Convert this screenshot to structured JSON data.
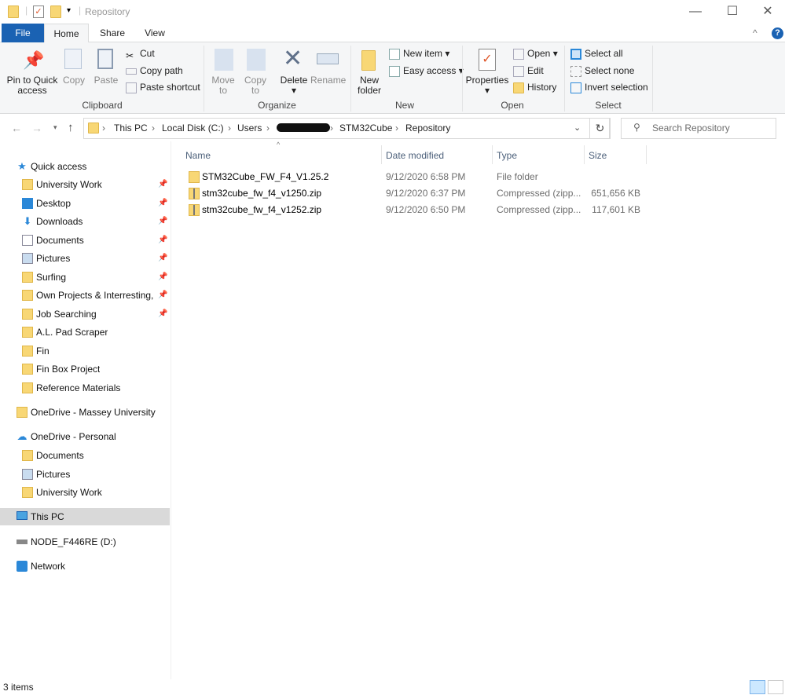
{
  "window": {
    "title": "Repository"
  },
  "tabs": [
    "File",
    "Home",
    "Share",
    "View"
  ],
  "ribbon": {
    "clipboard": {
      "label": "Clipboard",
      "pin": "Pin to Quick access",
      "copy": "Copy",
      "paste": "Paste",
      "cut": "Cut",
      "copy_path": "Copy path",
      "paste_shortcut": "Paste shortcut"
    },
    "organize": {
      "label": "Organize",
      "move_to": "Move to",
      "copy_to": "Copy to",
      "delete": "Delete",
      "rename": "Rename"
    },
    "new": {
      "label": "New",
      "new_folder": "New folder",
      "new_item": "New item",
      "easy_access": "Easy access"
    },
    "open": {
      "label": "Open",
      "properties": "Properties",
      "open": "Open",
      "edit": "Edit",
      "history": "History"
    },
    "select": {
      "label": "Select",
      "select_all": "Select all",
      "select_none": "Select none",
      "invert": "Invert selection"
    }
  },
  "address": {
    "crumbs": [
      "This PC",
      "Local Disk (C:)",
      "Users",
      "STM32Cube",
      "Repository"
    ]
  },
  "search": {
    "placeholder": "Search Repository"
  },
  "sidebar": {
    "quick_access": "Quick access",
    "quick_items": [
      "University Work",
      "Desktop",
      "Downloads",
      "Documents",
      "Pictures",
      "Surfing",
      "Own Projects & Interresting,",
      "Job Searching",
      "A.L. Pad Scraper",
      "Fin",
      "Fin Box Project",
      "Reference Materials"
    ],
    "onedrive_massey": "OneDrive - Massey University",
    "onedrive_personal": "OneDrive - Personal",
    "onedrive_items": [
      "Documents",
      "Pictures",
      "University Work"
    ],
    "this_pc": "This PC",
    "drive": "NODE_F446RE (D:)",
    "network": "Network"
  },
  "columns": [
    "Name",
    "Date modified",
    "Type",
    "Size"
  ],
  "files": [
    {
      "name": "STM32Cube_FW_F4_V1.25.2",
      "date": "9/12/2020 6:58 PM",
      "type": "File folder",
      "size": ""
    },
    {
      "name": "stm32cube_fw_f4_v1250.zip",
      "date": "9/12/2020 6:37 PM",
      "type": "Compressed (zipp...",
      "size": "651,656 KB"
    },
    {
      "name": "stm32cube_fw_f4_v1252.zip",
      "date": "9/12/2020 6:50 PM",
      "type": "Compressed (zipp...",
      "size": "117,601 KB"
    }
  ],
  "status": {
    "count": "3 items"
  }
}
